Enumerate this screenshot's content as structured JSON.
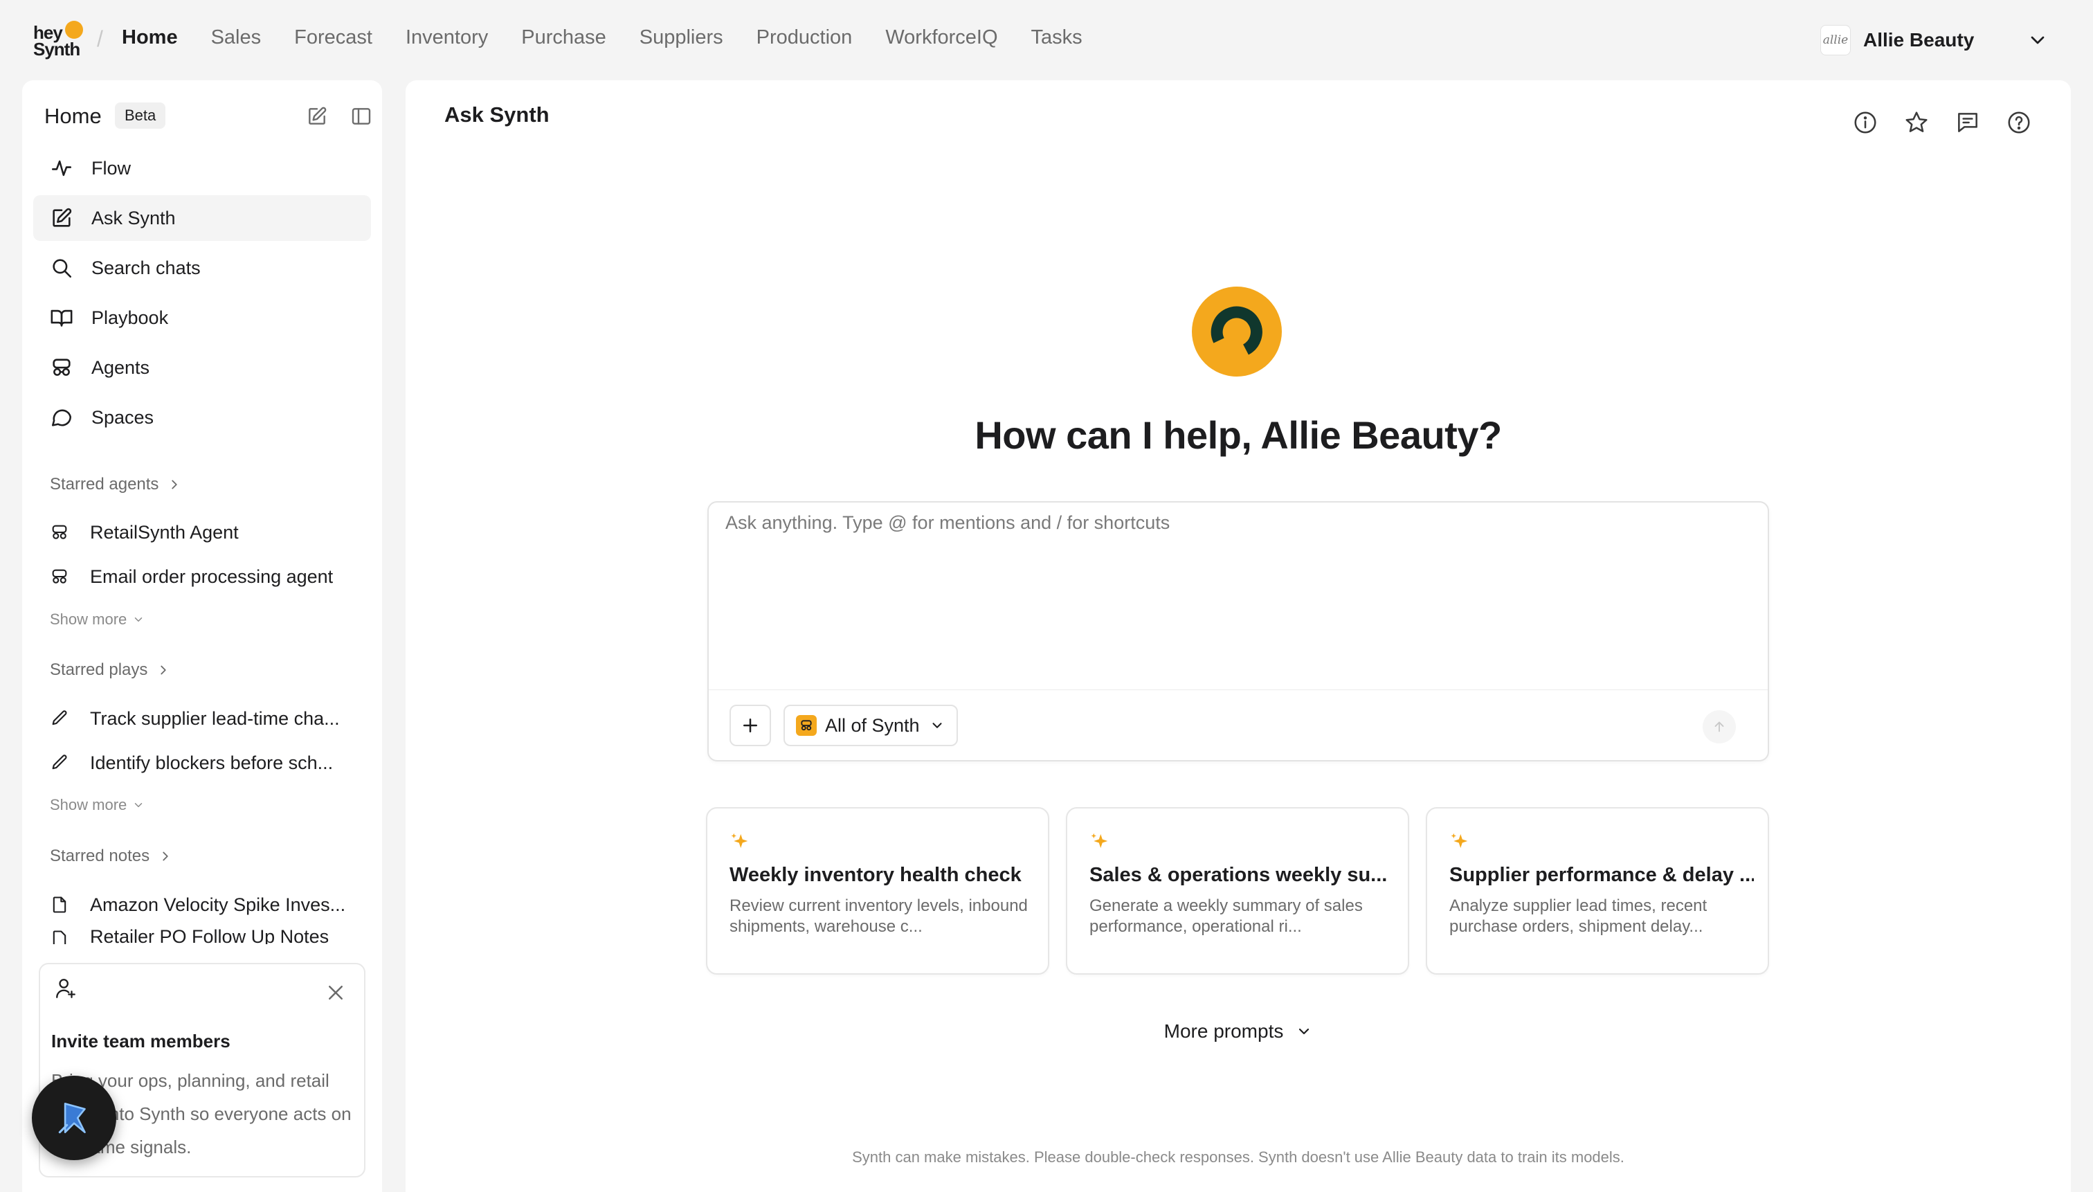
{
  "brand": {
    "line1": "hey",
    "line2": "Synth",
    "accent": "#f4a81d"
  },
  "nav": {
    "items": [
      "Home",
      "Sales",
      "Forecast",
      "Inventory",
      "Purchase",
      "Suppliers",
      "Production",
      "WorkforceIQ",
      "Tasks"
    ],
    "active": "Home"
  },
  "account": {
    "logo_text": "allie",
    "name": "Allie Beauty"
  },
  "sidebar": {
    "title": "Home",
    "badge": "Beta",
    "menu": [
      {
        "label": "Flow",
        "icon": "activity-icon"
      },
      {
        "label": "Ask Synth",
        "icon": "edit-icon"
      },
      {
        "label": "Search chats",
        "icon": "search-icon"
      },
      {
        "label": "Playbook",
        "icon": "book-icon"
      },
      {
        "label": "Agents",
        "icon": "agent-icon"
      },
      {
        "label": "Spaces",
        "icon": "chat-bubble-icon"
      }
    ],
    "starred_agents": {
      "heading": "Starred agents",
      "items": [
        "RetailSynth Agent",
        "Email order processing agent"
      ],
      "show_more": "Show more"
    },
    "starred_plays": {
      "heading": "Starred plays",
      "items": [
        "Track supplier lead-time cha...",
        "Identify blockers before sch..."
      ],
      "show_more": "Show more"
    },
    "starred_notes": {
      "heading": "Starred notes",
      "items": [
        "Amazon Velocity Spike Inves...",
        "Retailer PO Follow Up Notes"
      ]
    },
    "invite": {
      "title": "Invite team members",
      "body": "Bring your ops, planning, and retail teams into Synth so everyone acts on the same signals."
    }
  },
  "main": {
    "title": "Ask Synth",
    "greeting": "How can I help, Allie Beauty?",
    "composer": {
      "placeholder": "Ask anything. Type @ for mentions and / for shortcuts",
      "value": "",
      "scope": "All of Synth"
    },
    "cards": [
      {
        "title": "Weekly inventory health check",
        "desc": "Review current inventory levels, inbound shipments, warehouse c..."
      },
      {
        "title": "Sales & operations weekly su...",
        "desc": "Generate a weekly summary of sales performance, operational ri..."
      },
      {
        "title": "Supplier performance & delay ...",
        "desc": "Analyze supplier lead times, recent purchase orders, shipment delay..."
      }
    ],
    "more_prompts": "More prompts",
    "disclaimer": "Synth can make mistakes. Please double-check responses. Synth doesn't use Allie Beauty data to train its models."
  }
}
